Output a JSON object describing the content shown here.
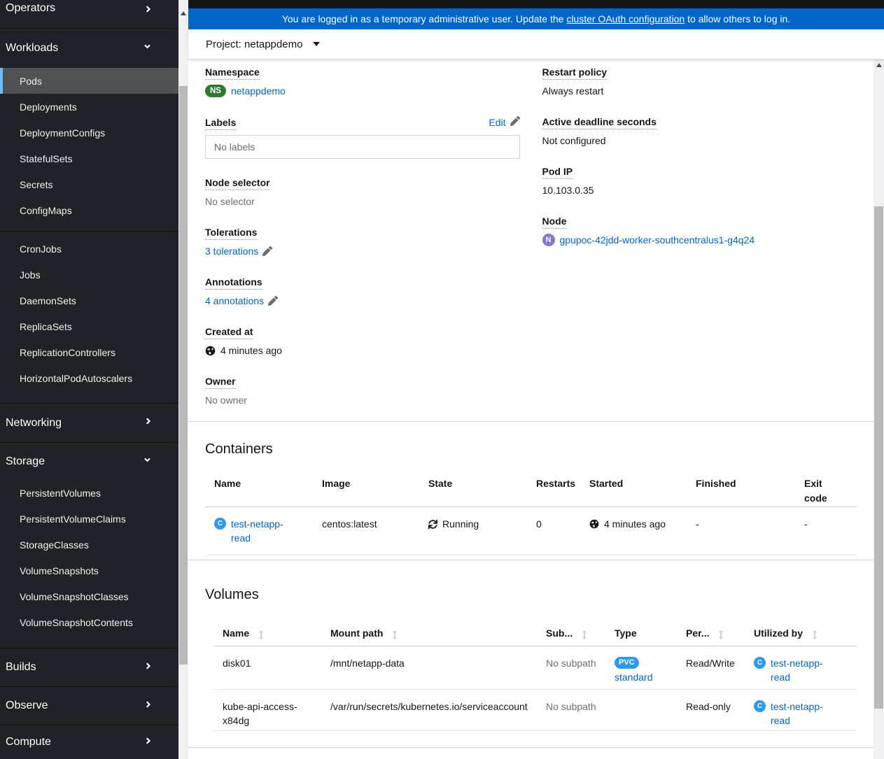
{
  "banner": {
    "text_before": "You are logged in as a temporary administrative user. Update the ",
    "link": "cluster OAuth configuration",
    "text_after": " to allow others to log in."
  },
  "project_bar": {
    "label": "Project: netappdemo"
  },
  "sidebar": {
    "operators": "Operators",
    "workloads": {
      "label": "Workloads",
      "items": [
        "Pods",
        "Deployments",
        "DeploymentConfigs",
        "StatefulSets",
        "Secrets",
        "ConfigMaps",
        "CronJobs",
        "Jobs",
        "DaemonSets",
        "ReplicaSets",
        "ReplicationControllers",
        "HorizontalPodAutoscalers"
      ],
      "selected": "Pods"
    },
    "networking": "Networking",
    "storage": {
      "label": "Storage",
      "items": [
        "PersistentVolumes",
        "PersistentVolumeClaims",
        "StorageClasses",
        "VolumeSnapshots",
        "VolumeSnapshotClasses",
        "VolumeSnapshotContents"
      ]
    },
    "builds": "Builds",
    "observe": "Observe",
    "compute": "Compute"
  },
  "details": {
    "namespace": {
      "label": "Namespace",
      "badge": "NS",
      "value": "netappdemo"
    },
    "labels": {
      "label": "Labels",
      "edit": "Edit",
      "empty": "No labels"
    },
    "node_selector": {
      "label": "Node selector",
      "value": "No selector"
    },
    "tolerations": {
      "label": "Tolerations",
      "value": "3 tolerations"
    },
    "annotations": {
      "label": "Annotations",
      "value": "4 annotations"
    },
    "created_at": {
      "label": "Created at",
      "value": "4 minutes ago"
    },
    "owner": {
      "label": "Owner",
      "value": "No owner"
    },
    "restart_policy": {
      "label": "Restart policy",
      "value": "Always restart"
    },
    "active_deadline": {
      "label": "Active deadline seconds",
      "value": "Not configured"
    },
    "pod_ip": {
      "label": "Pod IP",
      "value": "10.103.0.35"
    },
    "node": {
      "label": "Node",
      "badge": "N",
      "value": "gpupoc-42jdd-worker-southcentralus1-g4q24"
    }
  },
  "containers": {
    "title": "Containers",
    "headers": [
      "Name",
      "Image",
      "State",
      "Restarts",
      "Started",
      "Finished",
      "Exit code"
    ],
    "rows": [
      {
        "badge": "C",
        "name": "test-netapp-read",
        "image": "centos:latest",
        "state": "Running",
        "restarts": "0",
        "started": "4 minutes ago",
        "finished": "-",
        "exit_code": "-"
      }
    ]
  },
  "volumes": {
    "title": "Volumes",
    "headers": [
      "Name",
      "Mount path",
      "Sub...",
      "Type",
      "Per...",
      "Utilized by"
    ],
    "rows": [
      {
        "name": "disk01",
        "mount_path": "/mnt/netapp-data",
        "subpath": "No subpath",
        "type_badge": "PVC",
        "type_link": "standard",
        "permissions": "Read/Write",
        "utilized_badge": "C",
        "utilized_by": "test-netapp-read"
      },
      {
        "name": "kube-api-access-x84dg",
        "mount_path": "/var/run/secrets/kubernetes.io/serviceaccount",
        "subpath": "No subpath",
        "type_badge": "",
        "type_link": "",
        "permissions": "Read-only",
        "utilized_badge": "C",
        "utilized_by": "test-netapp-read"
      }
    ]
  },
  "colors": {
    "banner_blue": "#0066cc",
    "link_blue": "#0066cc",
    "sidebar_bg": "#1f2226",
    "selected_item_bg": "#4f5255",
    "selected_indicator": "#73bcf7",
    "ns_badge_green": "#2d7a2d",
    "node_badge_purple": "#8476d1",
    "container_badge_blue": "#2b9af3",
    "pvc_badge_blue": "#2b9af3"
  }
}
